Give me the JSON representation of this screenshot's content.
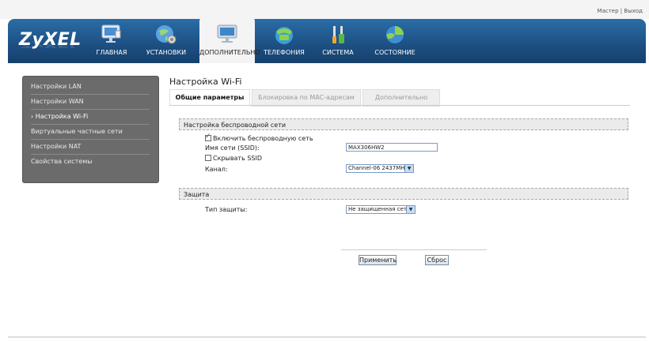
{
  "toplinks": {
    "master": "Мастер",
    "sep": "|",
    "logout": "Выход"
  },
  "logo": "ZyXEL",
  "nav": [
    {
      "label": "ГЛАВНАЯ",
      "icon": "monitor-home-icon"
    },
    {
      "label": "УСТАНОВКИ",
      "icon": "globe-settings-icon"
    },
    {
      "label": "ДОПОЛНИТЕЛЬНО",
      "icon": "monitor-advanced-icon"
    },
    {
      "label": "ТЕЛЕФОНИЯ",
      "icon": "phone-icon"
    },
    {
      "label": "СИСТЕМА",
      "icon": "tools-icon"
    },
    {
      "label": "СОСТОЯНИЕ",
      "icon": "status-globe-icon"
    }
  ],
  "sidebar": {
    "items": [
      {
        "label": "Настройки LAN"
      },
      {
        "label": "Настройки WAN"
      },
      {
        "label": "› Настройка Wi-Fi"
      },
      {
        "label": "Виртуальные частные сети"
      },
      {
        "label": "Настройки NAT"
      },
      {
        "label": "Свойства системы"
      }
    ]
  },
  "page": {
    "title": "Настройка Wi-Fi"
  },
  "tabs": [
    {
      "label": "Общие параметры"
    },
    {
      "label": "Блокировка по MAC-адресам"
    },
    {
      "label": "Дополнительно"
    }
  ],
  "wireless": {
    "section_title": "Настройка беспроводной сети",
    "enable_label": "Включить беспроводную сеть",
    "ssid_label": "Имя сети (SSID):",
    "ssid_value": "MAX306HW2",
    "hide_ssid_label": "Скрывать SSID",
    "channel_label": "Канал:",
    "channel_value": "Channel-06 2437MHz"
  },
  "security": {
    "section_title": "Защита",
    "type_label": "Тип защиты:",
    "type_value": "Не защищенная сеть"
  },
  "buttons": {
    "apply": "Применить",
    "reset": "Сброс"
  },
  "colors": {
    "header": "#1d4f82",
    "sidebar": "#6b6b6b",
    "accent": "#2a6da7"
  }
}
